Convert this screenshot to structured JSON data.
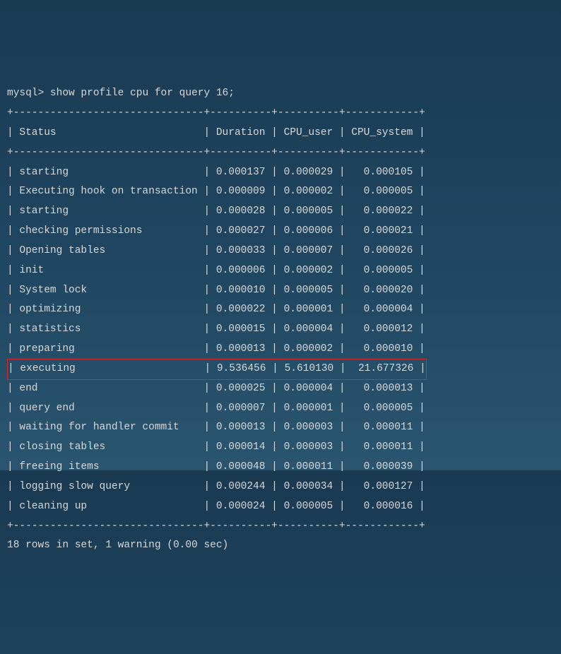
{
  "prompt": "mysql> ",
  "command": "show profile cpu for query 16;",
  "divider_top": "+-------------------------------+----------+----------+------------+",
  "header": "| Status                        | Duration | CPU_user | CPU_system |",
  "rows": [
    {
      "status": "starting",
      "duration": "0.000137",
      "cpu_user": "0.000029",
      "cpu_system": "0.000105",
      "hl": false
    },
    {
      "status": "Executing hook on transaction",
      "duration": "0.000009",
      "cpu_user": "0.000002",
      "cpu_system": "0.000005",
      "hl": false
    },
    {
      "status": "starting",
      "duration": "0.000028",
      "cpu_user": "0.000005",
      "cpu_system": "0.000022",
      "hl": false
    },
    {
      "status": "checking permissions",
      "duration": "0.000027",
      "cpu_user": "0.000006",
      "cpu_system": "0.000021",
      "hl": false
    },
    {
      "status": "Opening tables",
      "duration": "0.000033",
      "cpu_user": "0.000007",
      "cpu_system": "0.000026",
      "hl": false
    },
    {
      "status": "init",
      "duration": "0.000006",
      "cpu_user": "0.000002",
      "cpu_system": "0.000005",
      "hl": false
    },
    {
      "status": "System lock",
      "duration": "0.000010",
      "cpu_user": "0.000005",
      "cpu_system": "0.000020",
      "hl": false
    },
    {
      "status": "optimizing",
      "duration": "0.000022",
      "cpu_user": "0.000001",
      "cpu_system": "0.000004",
      "hl": false
    },
    {
      "status": "statistics",
      "duration": "0.000015",
      "cpu_user": "0.000004",
      "cpu_system": "0.000012",
      "hl": false
    },
    {
      "status": "preparing",
      "duration": "0.000013",
      "cpu_user": "0.000002",
      "cpu_system": "0.000010",
      "hl": false
    },
    {
      "status": "executing",
      "duration": "9.536456",
      "cpu_user": "5.610130",
      "cpu_system": "21.677326",
      "hl": true
    },
    {
      "status": "end",
      "duration": "0.000025",
      "cpu_user": "0.000004",
      "cpu_system": "0.000013",
      "hl": false
    },
    {
      "status": "query end",
      "duration": "0.000007",
      "cpu_user": "0.000001",
      "cpu_system": "0.000005",
      "hl": false
    },
    {
      "status": "waiting for handler commit",
      "duration": "0.000013",
      "cpu_user": "0.000003",
      "cpu_system": "0.000011",
      "hl": false
    },
    {
      "status": "closing tables",
      "duration": "0.000014",
      "cpu_user": "0.000003",
      "cpu_system": "0.000011",
      "hl": false
    },
    {
      "status": "freeing items",
      "duration": "0.000048",
      "cpu_user": "0.000011",
      "cpu_system": "0.000039",
      "hl": false
    },
    {
      "status": "logging slow query",
      "duration": "0.000244",
      "cpu_user": "0.000034",
      "cpu_system": "0.000127",
      "hl": false
    },
    {
      "status": "cleaning up",
      "duration": "0.000024",
      "cpu_user": "0.000005",
      "cpu_system": "0.000016",
      "hl": false
    }
  ],
  "footer": "18 rows in set, 1 warning (0.00 sec)",
  "col_widths": {
    "status": 29,
    "duration": 8,
    "cpu_user": 8,
    "cpu_system": 10
  }
}
